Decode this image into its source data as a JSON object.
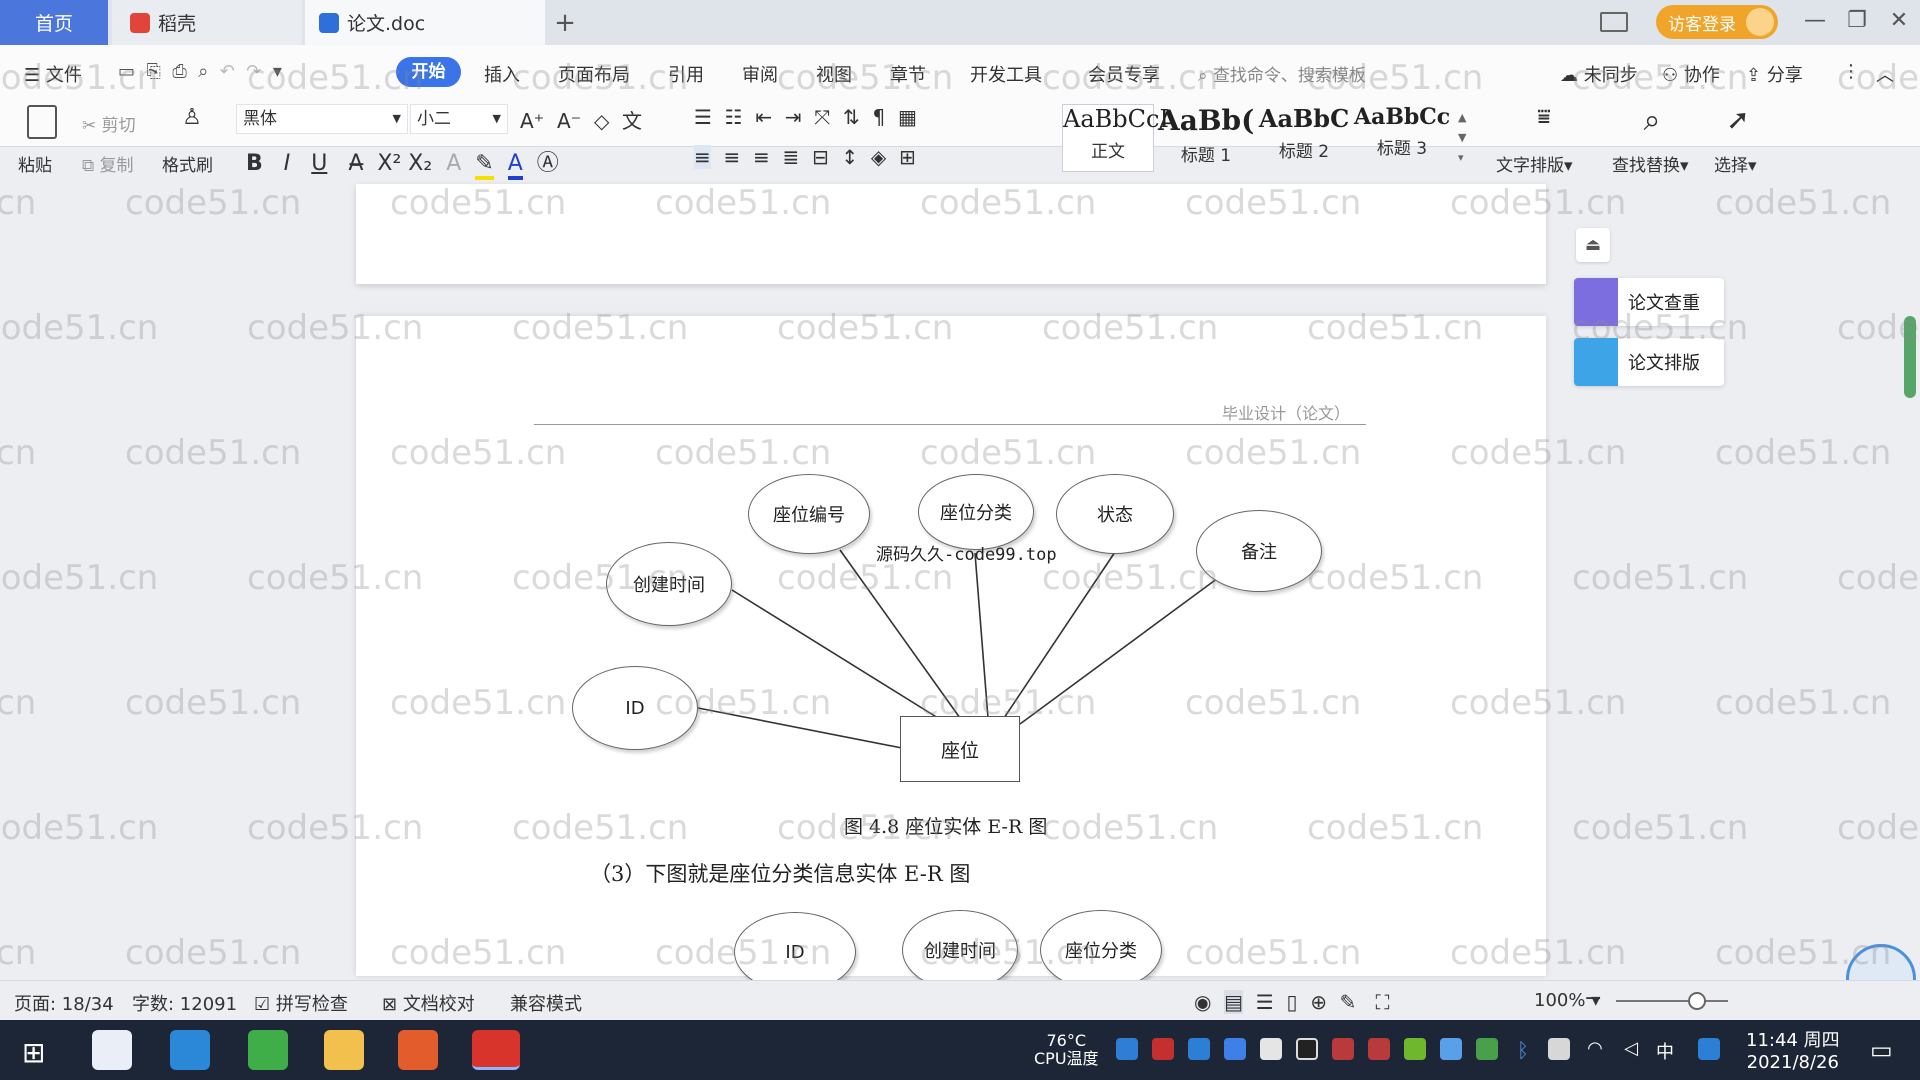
{
  "tabs": {
    "home": "首页",
    "daoke": "稻壳",
    "doc": "论文.doc",
    "add": "+"
  },
  "titlebar": {
    "visitor_login": "访客登录",
    "min": "—",
    "restore": "❐",
    "close": "✕"
  },
  "menu": {
    "file": "文件",
    "start": "开始",
    "insert": "插入",
    "layout": "页面布局",
    "reference": "引用",
    "review": "审阅",
    "view": "视图",
    "chapter": "章节",
    "devtools": "开发工具",
    "member": "会员专享",
    "search_placeholder": "查找命令、搜索模板",
    "unsynced": "未同步",
    "collab": "协作",
    "share": "分享"
  },
  "ribbon": {
    "paste": "粘贴",
    "cut": "剪切",
    "copy": "复制",
    "format_painter": "格式刷",
    "font_name": "黑体",
    "font_size": "小二",
    "bold": "B",
    "italic": "I",
    "underline": "U",
    "superscript": "X²",
    "subscript": "X₂",
    "styles": [
      {
        "preview": "AaBbCcI",
        "label": "正文"
      },
      {
        "preview": "AaBb(",
        "label": "标题 1"
      },
      {
        "preview": "AaBbC",
        "label": "标题 2"
      },
      {
        "preview": "AaBbCc",
        "label": "标题 3"
      }
    ],
    "text_layout": "文字排版",
    "find_replace": "查找替换",
    "select": "选择"
  },
  "side_panel": {
    "check": "论文查重",
    "format": "论文排版"
  },
  "document": {
    "header": "毕业设计（论文）",
    "diagram1": {
      "attrs": {
        "seat_no": "座位编号",
        "seat_cat": "座位分类",
        "status": "状态",
        "note": "备注",
        "created": "创建时间",
        "id": "ID"
      },
      "entity": "座位"
    },
    "watermark_src": "源码久久-code99.top",
    "caption": "图 4.8  座位实体 E-R 图",
    "body": "（3）下图就是座位分类信息实体 E-R 图",
    "diagram2": {
      "id": "ID",
      "created": "创建时间",
      "seat_cat": "座位分类"
    }
  },
  "watermark": "code51.cn",
  "statusbar": {
    "page": "页面: 18/34",
    "words": "字数: 12091",
    "spell": "拼写检查",
    "proof": "文档校对",
    "compat": "兼容模式",
    "zoom": "100%"
  },
  "taskbar": {
    "cpu_temp": "76°C",
    "cpu_label": "CPU温度",
    "time": "11:44 周四",
    "date": "2021/8/26",
    "ime": "中"
  }
}
